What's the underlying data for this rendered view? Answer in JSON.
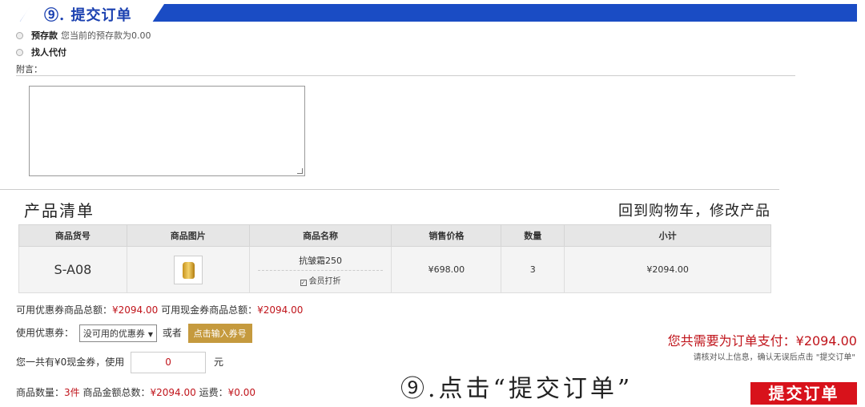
{
  "header": {
    "step_title": "⑨. 提交订单"
  },
  "payment": {
    "options": [
      {
        "label": "预存款",
        "note": "您当前的预存款为0.00"
      },
      {
        "label": "找人代付",
        "note": ""
      }
    ]
  },
  "memo": {
    "label": "附言：",
    "value": ""
  },
  "products": {
    "section_title": "产品清单",
    "back_link": "回到购物车，修改产品",
    "back_arrow": "››",
    "columns": [
      "商品货号",
      "商品图片",
      "商品名称",
      "销售价格",
      "数量",
      "小计"
    ],
    "rows": [
      {
        "sku": "S-A08",
        "name": "抗皱霜250",
        "member_discount": "会员打折",
        "price": "¥698.00",
        "qty": "3",
        "subtotal": "¥2094.00"
      }
    ]
  },
  "summary": {
    "coupon_total_label": "可用优惠券商品总额：",
    "coupon_total": "¥2094.00",
    "cash_total_label": "可用现金券商品总额：",
    "cash_total": "¥2094.00",
    "use_coupon_label": "使用优惠券：",
    "coupon_select": "没可用的优惠券",
    "or_label": "或者",
    "enter_code_button": "点击输入券号",
    "cash_voucher_label": "您一共有¥0现金券，使用",
    "cash_voucher_value": "0",
    "yuan": "元",
    "qty_label": "商品数量：",
    "qty_value": "3件",
    "goods_total_label": "商品金额总数：",
    "goods_total": "¥2094.00",
    "shipping_label": "运费：",
    "shipping": "¥0.00"
  },
  "checkout": {
    "total_text": "您共需要为订单支付：¥2094.00",
    "note": "请核对以上信息，确认无误后点击 \"提交订单\"",
    "instruction": "⑨.点击“提交订单”",
    "submit_button": "提交订单"
  },
  "colors": {
    "header_blue": "#1a4cc4",
    "price_red": "#c0141b",
    "gold_button": "#c59a3e",
    "submit_red": "#d8121b"
  }
}
